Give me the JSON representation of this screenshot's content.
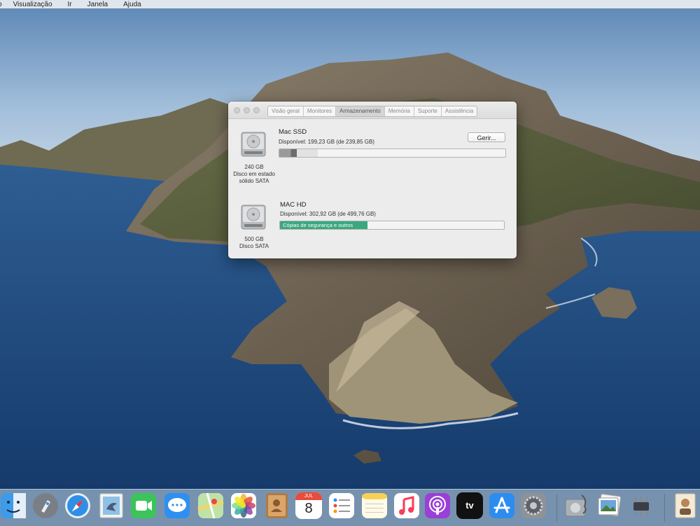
{
  "menubar": {
    "items": [
      "o",
      "Visualização",
      "Ir",
      "Janela",
      "Ajuda"
    ]
  },
  "window": {
    "tabs": [
      "Visão geral",
      "Monitores",
      "Armazenamento",
      "Memória",
      "Suporte",
      "Assistência"
    ],
    "active_tab": "Armazenamento",
    "manage_button": "Gerir...",
    "disks": [
      {
        "name": "Mac SSD",
        "available": "Disponível: 199,23 GB (de 239,85 GB)",
        "capacity": "240 GB",
        "type_line1": "Disco em estado",
        "type_line2": "sólido SATA",
        "used_fraction": 0.17,
        "bar_label": ""
      },
      {
        "name": "MAC HD",
        "available": "Disponível: 302,92 GB (de 499,76 GB)",
        "capacity": "500 GB",
        "type_line1": "Disco SATA",
        "used_fraction": 0.39,
        "bar_label": "Cópias de segurança e outros"
      }
    ]
  },
  "dock": {
    "calendar_month": "JUL",
    "calendar_day": "8",
    "tv_label": "tv",
    "apps": [
      "finder-icon",
      "launchpad-icon",
      "safari-icon",
      "mail-icon",
      "facetime-icon",
      "messages-icon",
      "maps-icon",
      "photos-icon",
      "contacts-icon",
      "calendar-icon",
      "reminders-icon",
      "notes-icon",
      "music-icon",
      "podcasts-icon",
      "apple-tv-icon",
      "app-store-icon",
      "system-preferences-icon",
      "disk-utility-icon",
      "preview-icon",
      "system-information-icon",
      "downloads-stack-icon"
    ]
  },
  "colors": {
    "backup_green": "#3aa87f",
    "sky": "#8fb3d6",
    "sea": "#1e4b86"
  }
}
